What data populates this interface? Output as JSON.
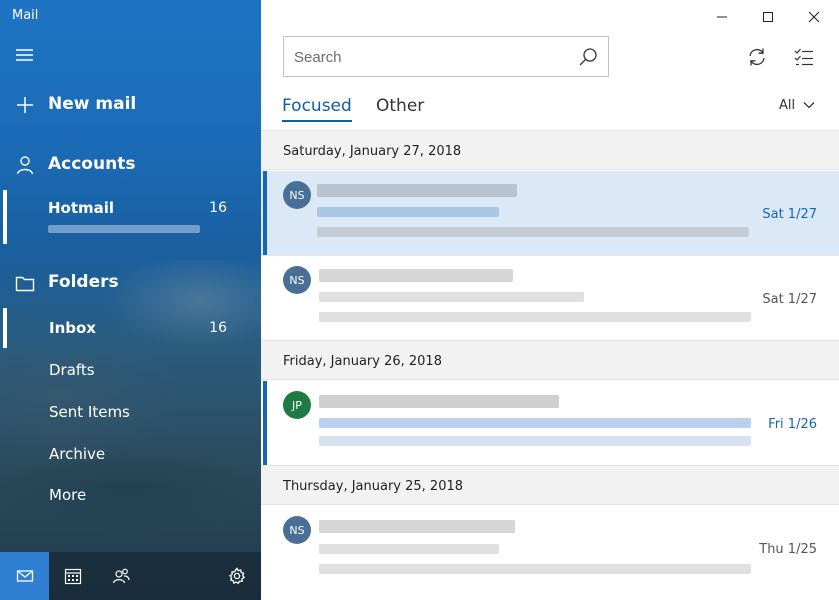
{
  "app": {
    "title": "Mail"
  },
  "sidebar": {
    "new_mail": "New mail",
    "accounts_label": "Accounts",
    "account": {
      "name": "Hotmail",
      "count": "16"
    },
    "folders_label": "Folders",
    "folders": [
      {
        "label": "Inbox",
        "count": "16"
      },
      {
        "label": "Drafts",
        "count": ""
      },
      {
        "label": "Sent Items",
        "count": ""
      },
      {
        "label": "Archive",
        "count": ""
      },
      {
        "label": "More",
        "count": ""
      }
    ],
    "bottom_icons": [
      "mail-icon",
      "calendar-icon",
      "people-icon",
      "gear-icon"
    ]
  },
  "search": {
    "placeholder": "Search",
    "value": ""
  },
  "tabs": {
    "focused": "Focused",
    "other": "Other"
  },
  "filter": {
    "label": "All"
  },
  "groups": [
    {
      "header": "Saturday, January 27, 2018",
      "messages": [
        {
          "initials": "NS",
          "date": "Sat 1/27",
          "selected": true
        },
        {
          "initials": "NS",
          "date": "Sat 1/27",
          "selected": false
        }
      ]
    },
    {
      "header": "Friday, January 26, 2018",
      "messages": [
        {
          "initials": "JP",
          "date": "Fri 1/26",
          "selected": false
        }
      ]
    },
    {
      "header": "Thursday, January 25, 2018",
      "messages": [
        {
          "initials": "NS",
          "date": "Thu 1/25",
          "selected": false
        }
      ]
    }
  ],
  "colors": {
    "accent": "#0f5ea8",
    "avatar_ns": "#4a6f96",
    "avatar_jp": "#1f7a44",
    "unread_date": "#1565b8"
  }
}
